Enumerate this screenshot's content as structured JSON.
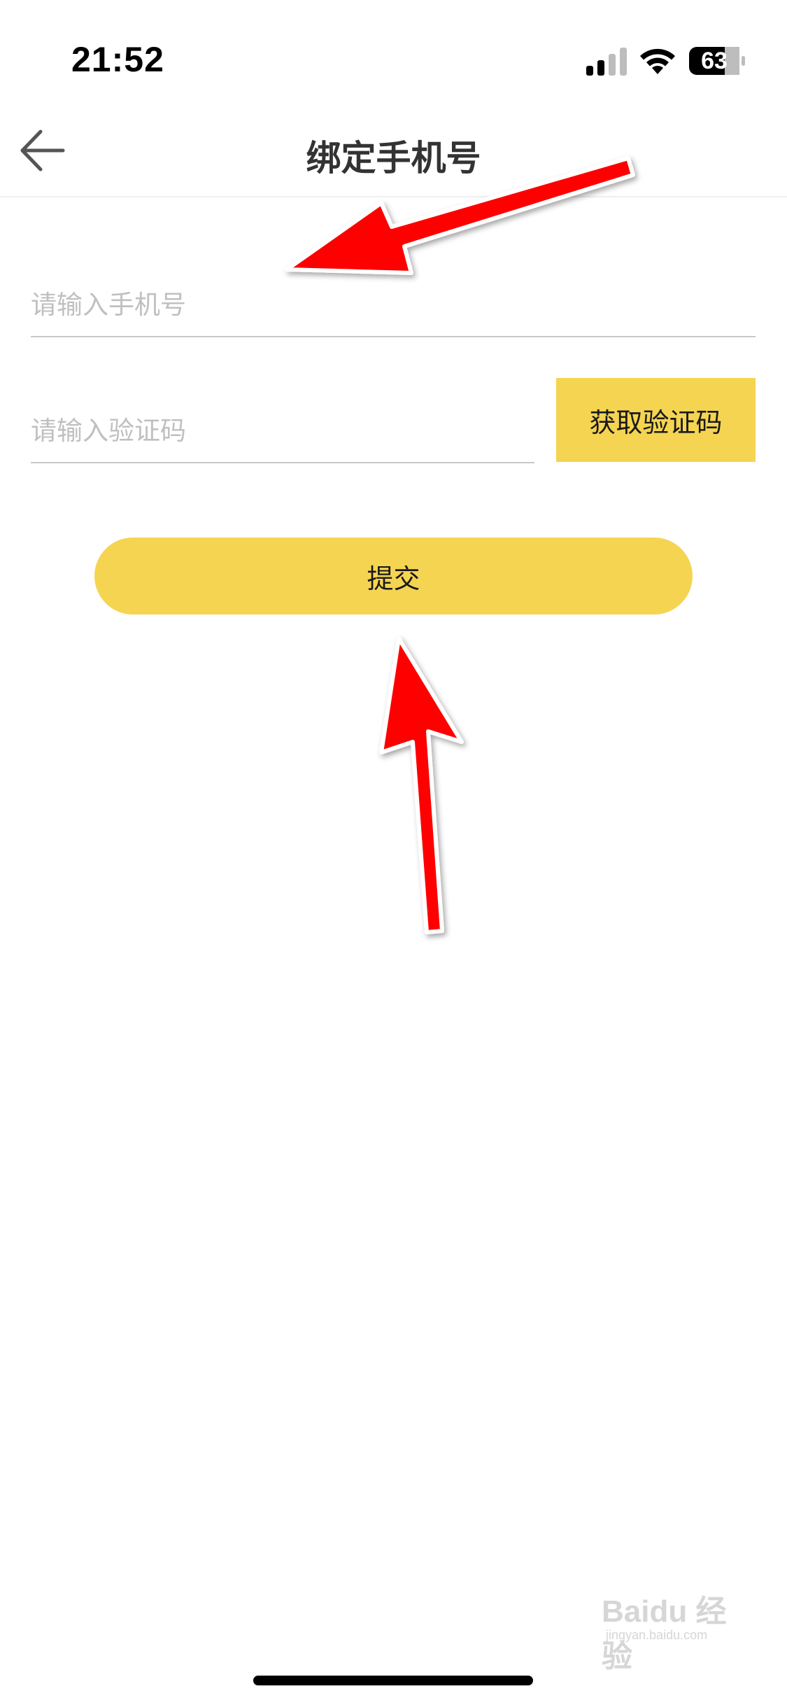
{
  "status_bar": {
    "time": "21:52",
    "battery_level": "63",
    "icons": [
      "signal-icon",
      "wifi-icon",
      "battery-icon"
    ]
  },
  "nav": {
    "back_icon": "arrow-left-icon",
    "title": "绑定手机号"
  },
  "form": {
    "phone_placeholder": "请输入手机号",
    "phone_value": "",
    "code_placeholder": "请输入验证码",
    "code_value": "",
    "get_code_label": "获取验证码",
    "submit_label": "提交"
  },
  "colors": {
    "accent": "#f5d452",
    "annotation_arrow": "#ff0000"
  },
  "watermark": {
    "brand": "Baidu 经验",
    "url": "jingyan.baidu.com"
  }
}
